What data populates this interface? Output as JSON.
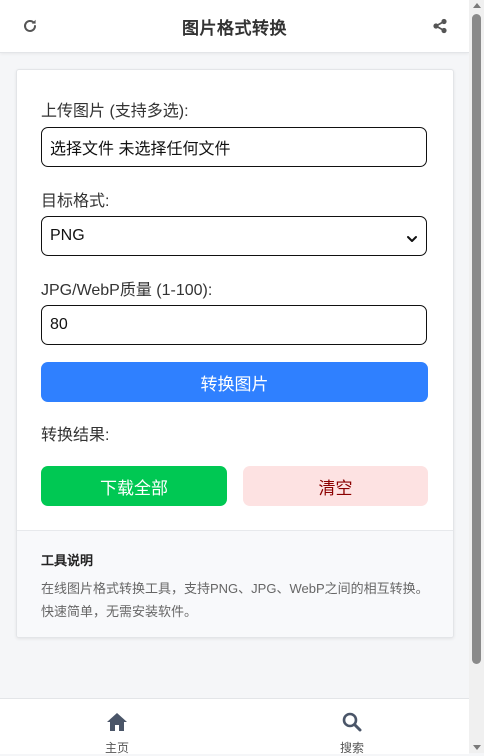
{
  "header": {
    "title": "图片格式转换",
    "refresh_icon": "refresh-icon",
    "share_icon": "share-icon"
  },
  "form": {
    "upload_label": "上传图片 (支持多选):",
    "file_input_text": "选择文件 未选择任何文件",
    "format_label": "目标格式:",
    "format_selected": "PNG",
    "quality_label": "JPG/WebP质量 (1-100):",
    "quality_value": "80",
    "convert_button": "转换图片",
    "result_label": "转换结果:",
    "download_all_button": "下载全部",
    "clear_button": "清空"
  },
  "info": {
    "title": "工具说明",
    "text": "在线图片格式转换工具，支持PNG、JPG、WebP之间的相互转换。快速简单，无需安装软件。"
  },
  "bottom_nav": {
    "items": [
      {
        "label": "主页",
        "icon": "home-icon"
      },
      {
        "label": "搜索",
        "icon": "search-icon"
      }
    ]
  },
  "colors": {
    "primary": "#2f80ff",
    "success": "#00c853",
    "danger_bg": "#fde2e2",
    "danger_text": "#8b0000"
  }
}
